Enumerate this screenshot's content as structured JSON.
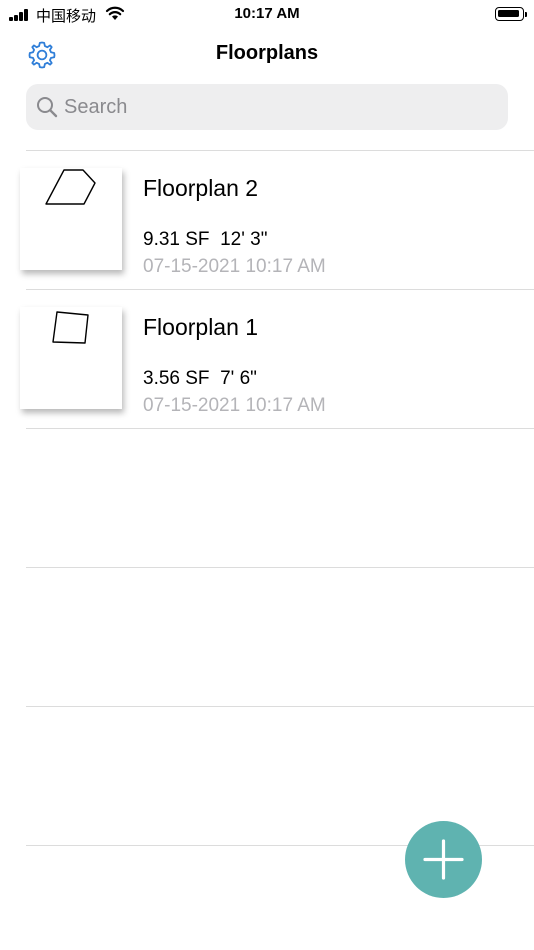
{
  "status_bar": {
    "carrier": "中国移动",
    "time": "10:17 AM"
  },
  "nav": {
    "title": "Floorplans",
    "settings_icon": "gear-icon"
  },
  "search": {
    "placeholder": "Search",
    "value": ""
  },
  "floorplans": [
    {
      "name": "Floorplan 2",
      "area": "9.31 SF",
      "perimeter": "12' 3\"",
      "date": "07-15-2021 10:17 AM"
    },
    {
      "name": "Floorplan 1",
      "area": "3.56 SF",
      "perimeter": "7' 6\"",
      "date": "07-15-2021 10:17 AM"
    }
  ],
  "fab": {
    "icon": "plus-icon",
    "color": "#5fb3b0"
  },
  "colors": {
    "accent": "#2f7ed8",
    "secondary_text": "#b4b4b8"
  }
}
